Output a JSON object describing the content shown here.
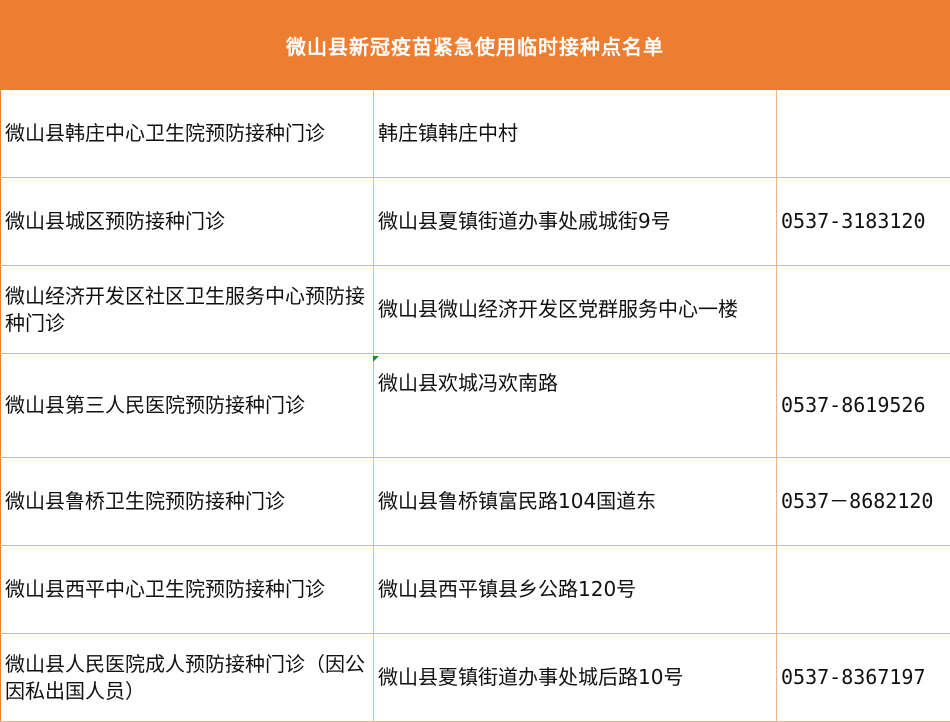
{
  "title": "微山县新冠疫苗紧急使用临时接种点名单",
  "rows": [
    {
      "name": "微山县韩庄中心卫生院预防接种门诊",
      "address": "韩庄镇韩庄中村",
      "phone": ""
    },
    {
      "name": "微山县城区预防接种门诊",
      "address": "微山县夏镇街道办事处戚城街9号",
      "phone": "0537-3183120"
    },
    {
      "name": "微山经济开发区社区卫生服务中心预防接种门诊",
      "address": "微山县微山经济开发区党群服务中心一楼",
      "phone": ""
    },
    {
      "name": "微山县第三人民医院预防接种门诊",
      "address": "微山县欢城冯欢南路",
      "phone": "0537-8619526"
    },
    {
      "name": "微山县鲁桥卫生院预防接种门诊",
      "address": "微山县鲁桥镇富民路104国道东",
      "phone": "0537－8682120"
    },
    {
      "name": "微山县西平中心卫生院预防接种门诊",
      "address": "微山县西平镇县乡公路120号",
      "phone": ""
    },
    {
      "name": "微山县人民医院成人预防接种门诊（因公因私出国人员）",
      "address": "微山县夏镇街道办事处城后路10号",
      "phone": "0537-8367197"
    }
  ]
}
